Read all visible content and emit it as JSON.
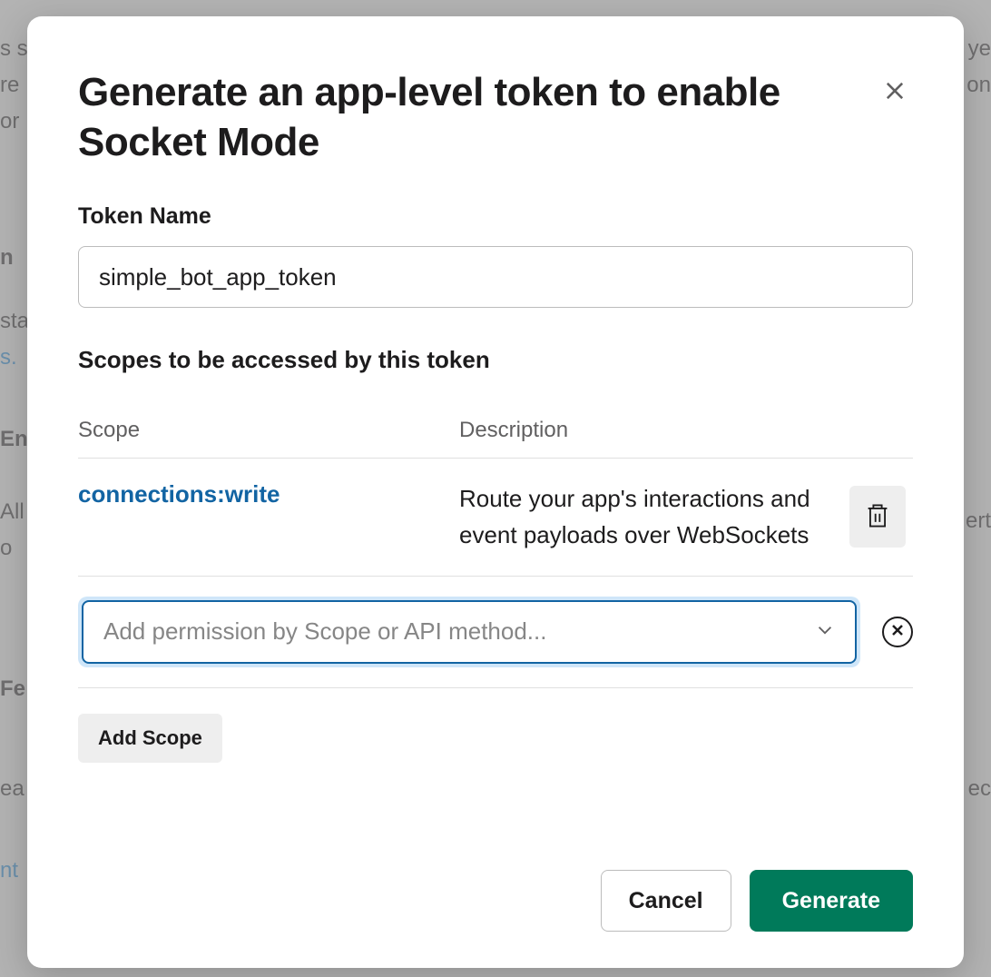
{
  "modal": {
    "title": "Generate an app-level token to enable Socket Mode",
    "token_name_label": "Token Name",
    "token_name_value": "simple_bot_app_token",
    "scopes_heading": "Scopes to be accessed by this token",
    "columns": {
      "scope": "Scope",
      "description": "Description"
    },
    "scopes": [
      {
        "name": "connections:write",
        "description": "Route your app's interactions and event payloads over WebSockets"
      }
    ],
    "scope_dropdown_placeholder": "Add permission by Scope or API method...",
    "add_scope_label": "Add Scope",
    "cancel_label": "Cancel",
    "generate_label": "Generate"
  },
  "background_fragments": {
    "a": "s s",
    "b": "re",
    "c": "or",
    "d": "n",
    "e": "sta",
    "f": "s.",
    "g": "En",
    "h": "All",
    "i": "o",
    "j": "Fe",
    "k": "ea",
    "l": "nt",
    "m": "ye",
    "n": "on",
    "o": "ert",
    "p": "ec"
  }
}
